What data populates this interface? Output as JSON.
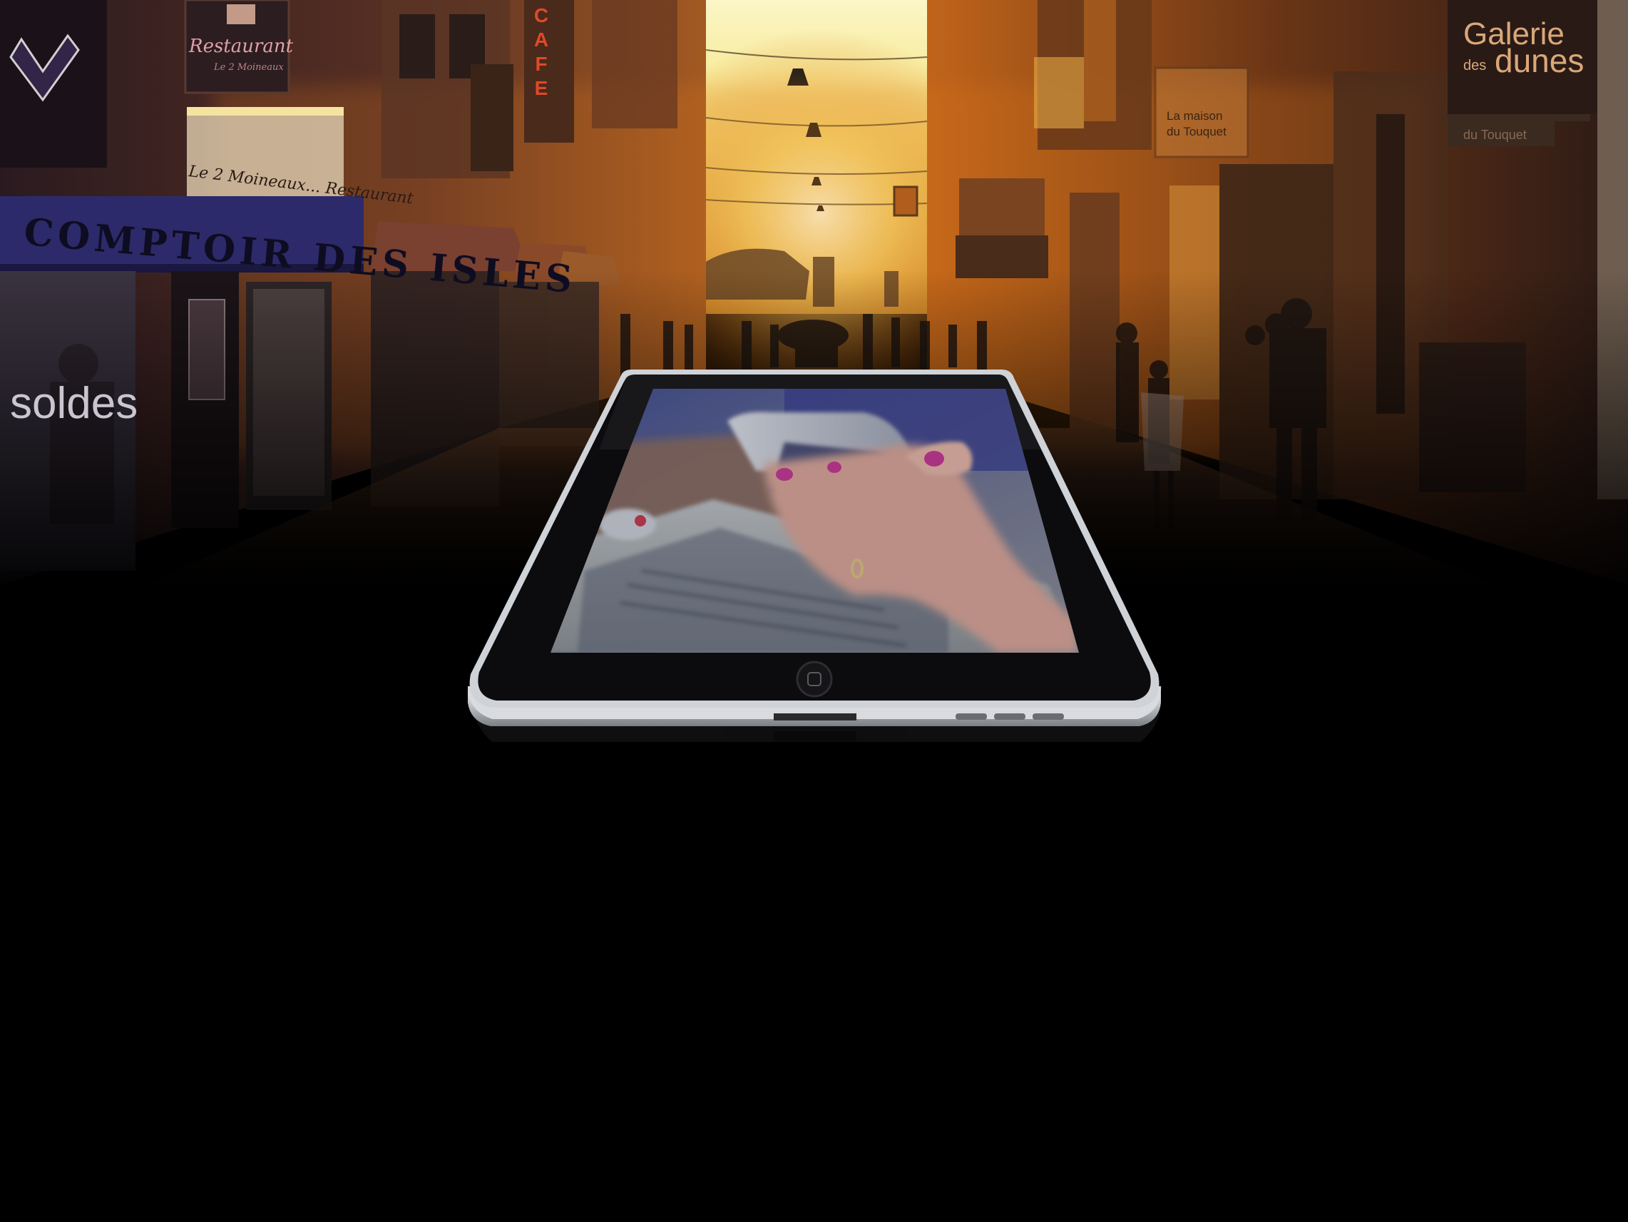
{
  "scene": {
    "description_free": true,
    "colors": {
      "sky_glow": "#f7ef9a",
      "sunset_orange": "#e07a1f",
      "dark": "#000000",
      "storefront_blue": "#2d2a6b",
      "sign_copper": "#c8915a"
    }
  },
  "signs": {
    "galerie_line1": "Galerie",
    "galerie_line2_prefix": "des",
    "galerie_line2_main": "dunes",
    "galerie_sub": "du Touquet",
    "restaurant": "Restaurant",
    "restaurant_sub": "Le 2 Moineaux",
    "moineaux": "Le 2 Moineaux... Restaurant",
    "comptoir": "COMPTOIR DES ISLES",
    "soldes": "soldes",
    "cafe": "CAFE",
    "maison_line1": "La maison",
    "maison_line2": "du Touquet"
  },
  "tablet": {
    "screen_image": "hand-holding-phone-over-laptop",
    "icons": {
      "home_button": "home-button-icon",
      "dock_connector": "dock-connector-icon",
      "speaker": "speaker-grille-icon"
    }
  }
}
